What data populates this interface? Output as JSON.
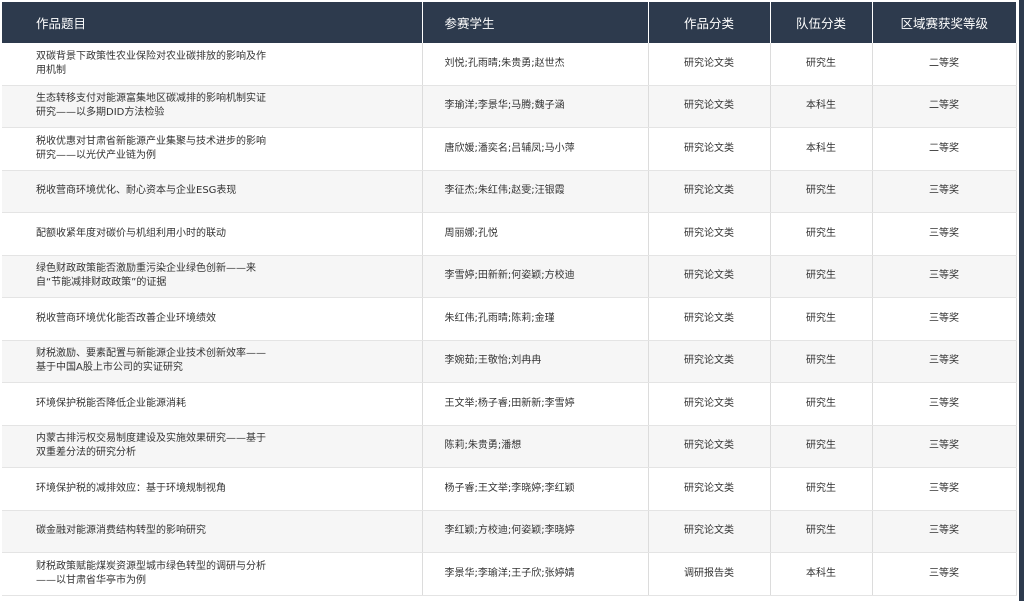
{
  "headers": [
    "作品题目",
    "参赛学生",
    "作品分类",
    "队伍分类",
    "区域赛获奖等级"
  ],
  "rows": [
    {
      "title": "双碳背景下政策性农业保险对农业碳排放的影响及作用机制",
      "students": "刘悦;孔雨晴;朱贵勇;赵世杰",
      "category": "研究论文类",
      "team": "研究生",
      "award": "二等奖"
    },
    {
      "title": "生态转移支付对能源富集地区碳减排的影响机制实证研究——以多期DID方法检验",
      "students": "李瑜洋;李景华;马腾;魏子涵",
      "category": "研究论文类",
      "team": "本科生",
      "award": "二等奖"
    },
    {
      "title": "税收优惠对甘肃省新能源产业集聚与技术进步的影响研究——以光伏产业链为例",
      "students": "唐欣媛;潘奕名;吕辅凤;马小萍",
      "category": "研究论文类",
      "team": "本科生",
      "award": "二等奖"
    },
    {
      "title": "税收营商环境优化、耐心资本与企业ESG表现",
      "students": "李征杰;朱红伟;赵雯;汪银霞",
      "category": "研究论文类",
      "team": "研究生",
      "award": "三等奖"
    },
    {
      "title": "配额收紧年度对碳价与机组利用小时的联动",
      "students": "周丽娜;孔悦",
      "category": "研究论文类",
      "team": "研究生",
      "award": "三等奖"
    },
    {
      "title": "绿色财政政策能否激励重污染企业绿色创新——来自“节能减排财政政策”的证据",
      "students": "李雪婷;田新新;何姿颖;方校迪",
      "category": "研究论文类",
      "team": "研究生",
      "award": "三等奖"
    },
    {
      "title": "税收营商环境优化能否改善企业环境绩效",
      "students": "朱红伟;孔雨晴;陈莉;金瑾",
      "category": "研究论文类",
      "team": "研究生",
      "award": "三等奖"
    },
    {
      "title": "财税激励、要素配置与新能源企业技术创新效率——基于中国A股上市公司的实证研究",
      "students": "李婉茹;王敬怡;刘冉冉",
      "category": "研究论文类",
      "team": "研究生",
      "award": "三等奖"
    },
    {
      "title": "环境保护税能否降低企业能源消耗",
      "students": "王文举;杨子睿;田新新;李雪婷",
      "category": "研究论文类",
      "team": "研究生",
      "award": "三等奖"
    },
    {
      "title": "内蒙古排污权交易制度建设及实施效果研究——基于双重差分法的研究分析",
      "students": "陈莉;朱贵勇;潘想",
      "category": "研究论文类",
      "team": "研究生",
      "award": "三等奖"
    },
    {
      "title": "环境保护税的减排效应：基于环境规制视角",
      "students": "杨子睿;王文举;李晓婷;李红颖",
      "category": "研究论文类",
      "team": "研究生",
      "award": "三等奖"
    },
    {
      "title": "碳金融对能源消费结构转型的影响研究",
      "students": "李红颖;方校迪;何姿颖;李晓婷",
      "category": "研究论文类",
      "team": "研究生",
      "award": "三等奖"
    },
    {
      "title": "财税政策赋能煤炭资源型城市绿色转型的调研与分析——以甘肃省华亭市为例",
      "students": "李景华;李瑜洋;王子欣;张婷婧",
      "category": "调研报告类",
      "team": "本科生",
      "award": "三等奖"
    }
  ]
}
